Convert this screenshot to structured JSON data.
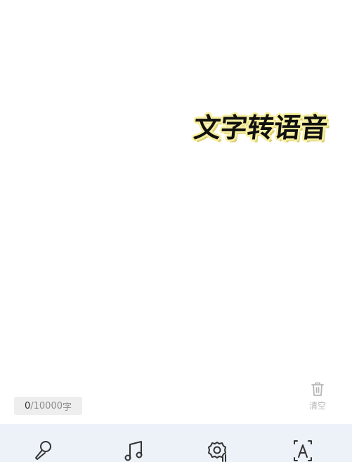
{
  "editor": {
    "overlay_title": "文字转语音"
  },
  "counter": {
    "current": "0",
    "separator": " /",
    "max": "10000",
    "unit": " 字"
  },
  "clear": {
    "label": "清空",
    "icon": "trash-icon"
  },
  "bottom_tabs": [
    {
      "icon": "microphone-icon"
    },
    {
      "icon": "music-note-icon"
    },
    {
      "icon": "settings-gear-icon"
    },
    {
      "icon": "text-box-icon"
    }
  ],
  "colors": {
    "background": "#ffffff",
    "bottom_bar": "#edf1f8",
    "counter_bg": "#eeeeee",
    "clear_gray": "#b8b8b8",
    "title_highlight": "#f7ef9f"
  }
}
